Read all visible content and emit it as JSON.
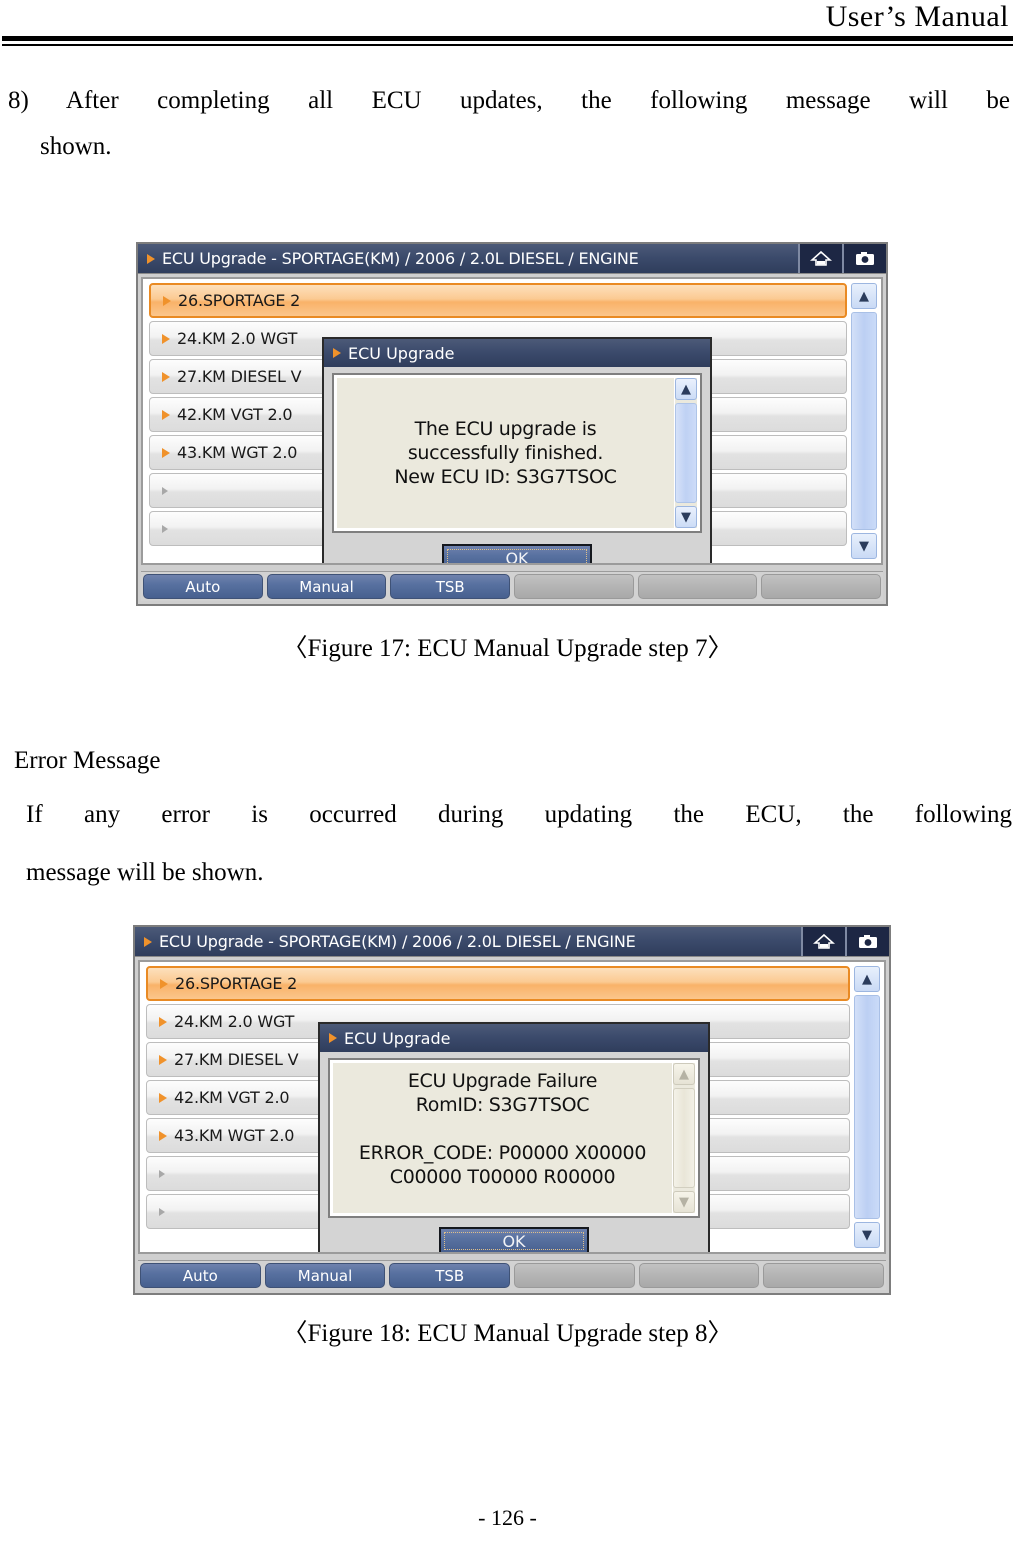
{
  "header": {
    "title": "User’s Manual"
  },
  "content": {
    "step8_line1": "8) After completing all ECU updates, the following message will be",
    "step8_line2": "shown.",
    "error_heading": "Error Message",
    "error_line1": "If any error is occurred during updating the ECU, the following",
    "error_line2": "message will be shown."
  },
  "captions": {
    "figure17": "〈Figure 17: ECU Manual Upgrade step 7〉",
    "figure18": "〈Figure 18: ECU Manual Upgrade step 8〉"
  },
  "page_number": "- 126 -",
  "screenshot": {
    "window_title": "ECU Upgrade - SPORTAGE(KM) / 2006 / 2.0L DIESEL / ENGINE",
    "title_icons": [
      "home-icon",
      "camera-icon"
    ],
    "list_items": [
      {
        "label": "26.SPORTAGE 2",
        "selected": true,
        "empty": false
      },
      {
        "label": "24.KM 2.0 WGT",
        "selected": false,
        "empty": false
      },
      {
        "label": "27.KM DIESEL V",
        "selected": false,
        "empty": false
      },
      {
        "label": "42.KM VGT 2.0",
        "selected": false,
        "empty": false
      },
      {
        "label": "43.KM WGT 2.0",
        "selected": false,
        "empty": false
      },
      {
        "label": "",
        "selected": false,
        "empty": true
      },
      {
        "label": "",
        "selected": false,
        "empty": true
      }
    ],
    "toolbar_buttons": [
      {
        "label": "Auto",
        "enabled": true
      },
      {
        "label": "Manual",
        "enabled": true
      },
      {
        "label": "TSB",
        "enabled": true
      },
      {
        "label": "",
        "enabled": false
      },
      {
        "label": "",
        "enabled": false
      },
      {
        "label": "",
        "enabled": false
      }
    ],
    "dialog_title": "ECU Upgrade",
    "ok_label": "OK"
  },
  "figure17": {
    "dialog_message": "The ECU upgrade is\nsuccessfully finished.\nNew ECU ID: S3G7TSOC"
  },
  "figure18": {
    "dialog_message": "ECU Upgrade Failure\nRomID: S3G7TSOC\n\nERROR_CODE: P00000 X00000\nC00000 T00000 R00000"
  },
  "colors": {
    "titlebar": "#3b4a6b",
    "accent_orange": "#f0922b",
    "selected_row": "#f9b269",
    "button_blue": "#5871a0",
    "dialog_content": "#ebe9dd"
  }
}
